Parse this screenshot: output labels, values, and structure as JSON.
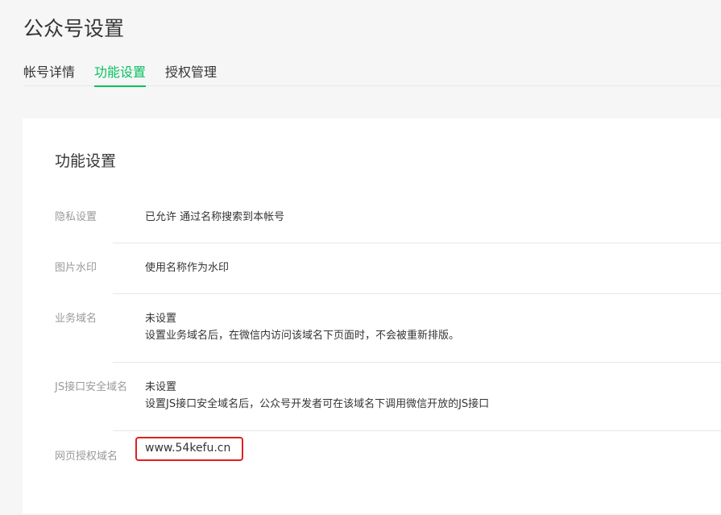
{
  "header": {
    "title": "公众号设置",
    "tabs": [
      {
        "label": "帐号详情"
      },
      {
        "label": "功能设置"
      },
      {
        "label": "授权管理"
      }
    ]
  },
  "card": {
    "title": "功能设置",
    "rows": [
      {
        "label": "隐私设置",
        "value": "已允许 通过名称搜索到本帐号"
      },
      {
        "label": "图片水印",
        "value": "使用名称作为水印"
      },
      {
        "label": "业务域名",
        "value": "未设置",
        "desc": "设置业务域名后，在微信内访问该域名下页面时，不会被重新排版。"
      },
      {
        "label": "JS接口安全域名",
        "value": "未设置",
        "desc": "设置JS接口安全域名后，公众号开发者可在该域名下调用微信开放的JS接口"
      },
      {
        "label": "网页授权域名",
        "value": "www.54kefu.cn"
      }
    ]
  },
  "colors": {
    "accent": "#07c160",
    "highlight_border": "#e02020"
  }
}
